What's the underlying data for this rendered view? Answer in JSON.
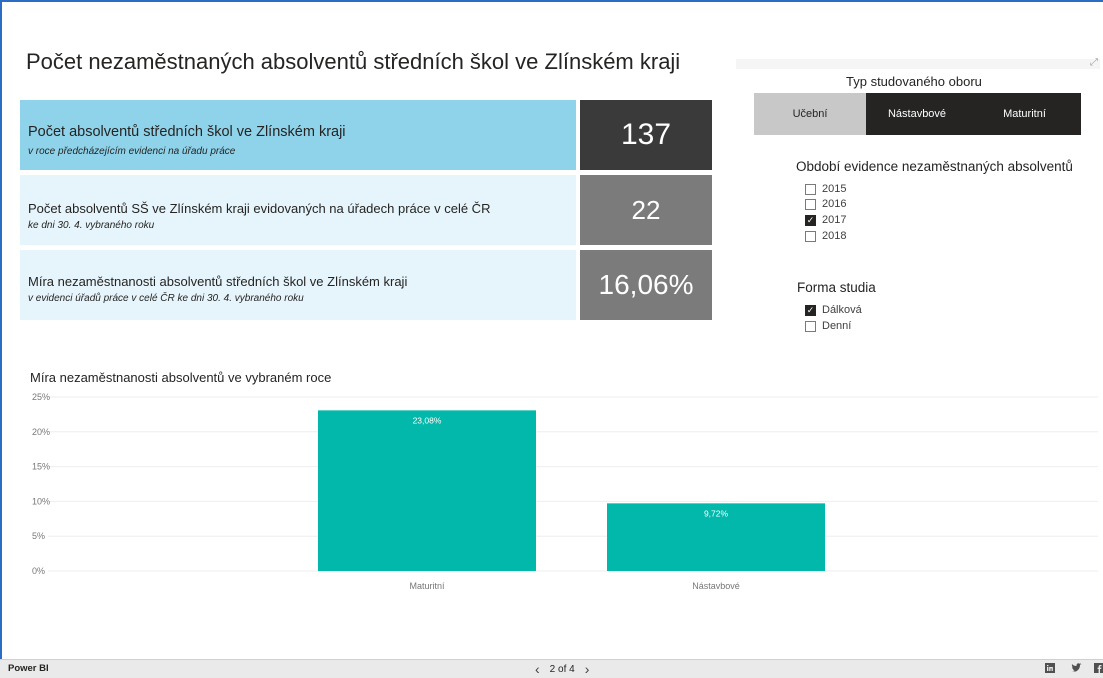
{
  "report": {
    "title": "Počet nezaměstnaných absolventů středních škol ve Zlínském kraji"
  },
  "kpis": [
    {
      "label": "Počet absolventů středních škol ve Zlínském kraji",
      "sublabel": "v roce předcházejícím evidenci na úřadu práce",
      "value": "137",
      "label_bg": "#8fd3ea",
      "value_bg": "#3a3a3a"
    },
    {
      "label": "Počet absolventů SŠ ve Zlínském kraji evidovaných na úřadech práce v celé ČR",
      "sublabel": "ke dni 30. 4. vybraného roku",
      "value": "22",
      "label_bg": "#e6f5fb",
      "value_bg": "#7b7b7b"
    },
    {
      "label": "Míra nezaměstnanosti absolventů středních škol ve Zlínském kraji",
      "sublabel": "v evidenci úřadů práce v celé ČR ke dni 30. 4. vybraného roku",
      "value": "16,06%",
      "label_bg": "#e6f5fb",
      "value_bg": "#7b7b7b"
    }
  ],
  "field_slicer": {
    "title": "Typ studovaného oboru",
    "options": [
      {
        "label": "Učební",
        "selected": true
      },
      {
        "label": "Nástavbové",
        "selected": false
      },
      {
        "label": "Maturitní",
        "selected": false
      }
    ]
  },
  "period_slicer": {
    "title": "Období evidence nezaměstnaných absolventů",
    "items": [
      {
        "label": "2015",
        "checked": false
      },
      {
        "label": "2016",
        "checked": false
      },
      {
        "label": "2017",
        "checked": true
      },
      {
        "label": "2018",
        "checked": false
      }
    ]
  },
  "form_slicer": {
    "title": "Forma studia",
    "items": [
      {
        "label": "Dálková",
        "checked": true
      },
      {
        "label": "Denní",
        "checked": false
      }
    ]
  },
  "chart_title": "Míra nezaměstnanosti absolventů ve vybraném roce",
  "chart_data": {
    "type": "bar",
    "categories": [
      "Maturitní",
      "Nástavbové"
    ],
    "values": [
      23.08,
      9.72
    ],
    "data_labels": [
      "23,08%",
      "9,72%"
    ],
    "y_ticks": [
      "0%",
      "5%",
      "10%",
      "15%",
      "20%",
      "25%"
    ],
    "ylim": [
      0,
      25
    ],
    "grid": true,
    "bar_color": "#01b8aa"
  },
  "footer": {
    "brand": "Power BI",
    "page_indicator": "2 of 4",
    "prev_icon": "chevron-left-icon",
    "next_icon": "chevron-right-icon",
    "share_icons": [
      "linkedin-icon",
      "twitter-icon",
      "facebook-icon"
    ]
  }
}
